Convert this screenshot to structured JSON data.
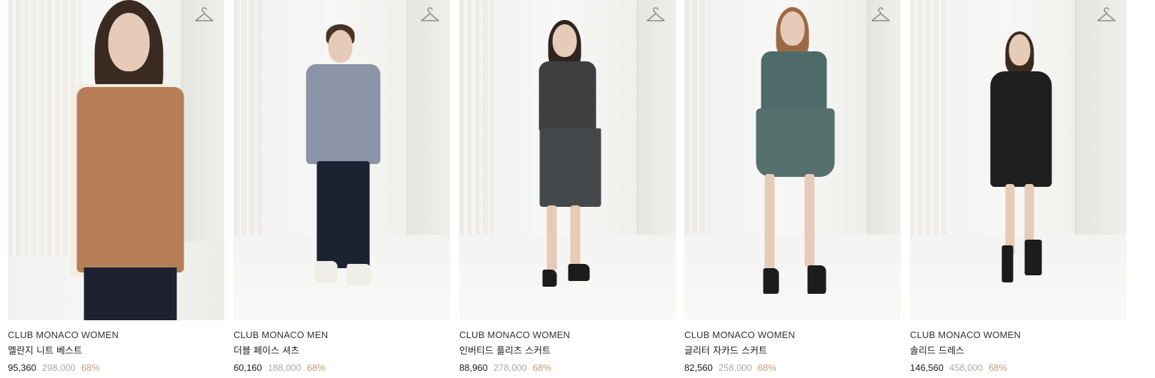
{
  "products": [
    {
      "brand": "CLUB MONACO WOMEN",
      "name": "멜란지 니트 베스트",
      "price": "95,360",
      "original_price": "298,000",
      "discount": "68%",
      "garment_color": "#b67f58"
    },
    {
      "brand": "CLUB MONACO MEN",
      "name": "더블 페이스 셔츠",
      "price": "60,160",
      "original_price": "188,000",
      "discount": "68%",
      "garment_color": "#8c93a6"
    },
    {
      "brand": "CLUB MONACO WOMEN",
      "name": "인버티드 플리츠 스커트",
      "price": "88,960",
      "original_price": "278,000",
      "discount": "68%",
      "garment_color": "#45484a"
    },
    {
      "brand": "CLUB MONACO WOMEN",
      "name": "글리터 자카드 스커트",
      "price": "82,560",
      "original_price": "258,000",
      "discount": "68%",
      "garment_color": "#4e6b6a"
    },
    {
      "brand": "CLUB MONACO WOMEN",
      "name": "솔리드 드레스",
      "price": "146,560",
      "original_price": "458,000",
      "discount": "68%",
      "garment_color": "#1f1f1f"
    }
  ],
  "icons": {
    "wishlist": "hanger-icon"
  },
  "colors": {
    "price": "#1a1a1a",
    "original_price": "#a9a9a9",
    "discount": "#c49a74"
  }
}
